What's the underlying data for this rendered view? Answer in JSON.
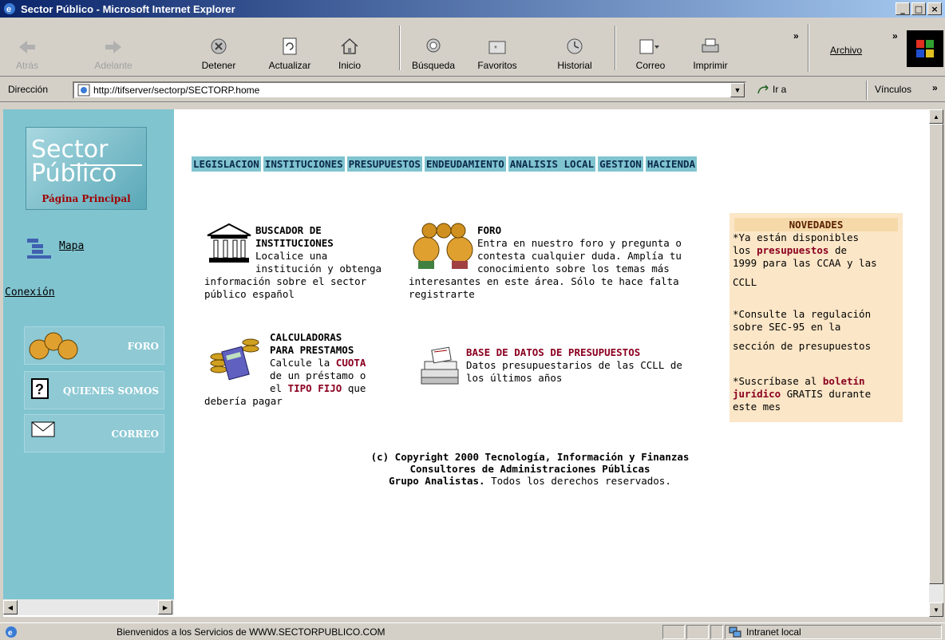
{
  "window": {
    "title": "Sector Público - Microsoft Internet Explorer"
  },
  "toolbar": {
    "back": "Atrás",
    "forward": "Adelante",
    "stop": "Detener",
    "refresh": "Actualizar",
    "home": "Inicio",
    "search": "Búsqueda",
    "favorites": "Favoritos",
    "history": "Historial",
    "mail": "Correo",
    "print": "Imprimir",
    "file_menu": "Archivo",
    "chevron": "»"
  },
  "address": {
    "label": "Dirección",
    "url": "http://tifserver/sectorp/SECTORP.home",
    "go": "Ir a",
    "links": "Vínculos"
  },
  "sidebar": {
    "logo_line1": "ector",
    "logo_line2": "úblico",
    "logo_s": "S",
    "logo_p": "P",
    "logo_caption": "Página Principal",
    "mapa": "Mapa",
    "conexion": "Conexión",
    "foro_btn": "FORO",
    "quienes_btn": "QUIENES SOMOS",
    "correo_btn": "CORREO"
  },
  "nav": [
    "LEGISLACION",
    "INSTITUCIONES",
    "PRESUPUESTOS",
    "ENDEUDAMIENTO",
    "ANALISIS LOCAL",
    "GESTION",
    "HACIENDA"
  ],
  "buscador": {
    "title1": "BUSCADOR DE",
    "title2": "INSTITUCIONES",
    "l1": "Localice una",
    "l2": "institución y obtenga",
    "l3": "información sobre el sector",
    "l4": "público español"
  },
  "foro": {
    "title": "FORO",
    "l1": "Entra en nuestro foro y pregunta o",
    "l2": "contesta cualquier duda. Amplía tu",
    "l3": "conocimiento sobre los temas más",
    "l4": "interesantes en este área. Sólo te hace falta",
    "l5": "registrarte"
  },
  "calc": {
    "title1": "CALCULADORAS",
    "title2": "PARA PRESTAMOS",
    "l1a": "Calcule la ",
    "l1b": "CUOTA",
    "l2": "de un préstamo o",
    "l3a": "el ",
    "l3b": "TIPO FIJO",
    "l3c": " que",
    "l4": "debería pagar"
  },
  "bd": {
    "title": "BASE DE DATOS DE PRESUPUESTOS",
    "l1": "Datos presupuestarios de las CCLL de",
    "l2": "los últimos años"
  },
  "novedades": {
    "header": "NOVEDADES",
    "n1a": "*Ya están disponibles",
    "n1b": "los ",
    "n1c": "presupuestos",
    "n1d": " de",
    "n1e": "1999 para las CCAA y las",
    "n1f": "CCLL",
    "n2a": "*Consulte la regulación",
    "n2b": "sobre SEC-95 en la",
    "n2c": "sección de presupuestos",
    "n3a": "*Suscríbase al ",
    "n3b": "boletín",
    "n3c": "jurídico",
    "n3d": " GRATIS durante",
    "n3e": "este mes"
  },
  "copyright": {
    "l1": "(c) Copyright 2000 Tecnología, Información y Finanzas",
    "l2": "Consultores de Administraciones Públicas",
    "l3a": "Grupo Analistas.",
    "l3b": " Todos los derechos reservados."
  },
  "status": {
    "text": "Bienvenidos a los Servicios de WWW.SECTORPUBLICO.COM",
    "zone": "Intranet local"
  }
}
